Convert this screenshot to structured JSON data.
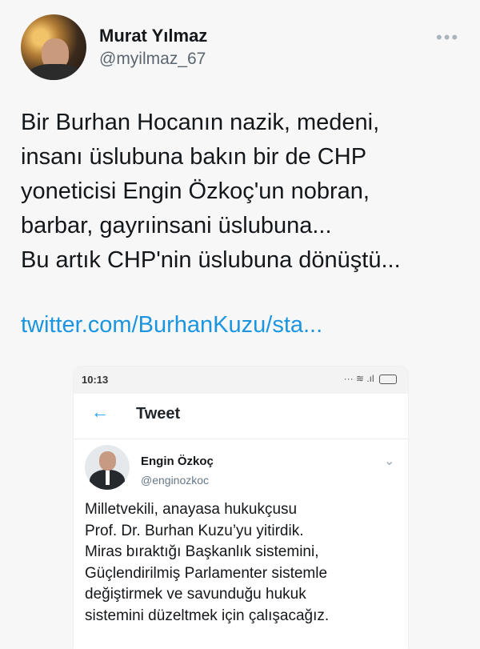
{
  "author": {
    "name": "Murat Yılmaz",
    "handle": "@myilmaz_67"
  },
  "more_icon": "ellipsis-icon",
  "tweet": {
    "text": "Bir Burhan Hocanın nazik, medeni,\ninsanı üslubuna bakın bir de CHP\nyoneticisi Engin Özkoç'un nobran,\nbarbar, gayrıinsani üslubuna...\nBu artık CHP'nin üslubuna dönüştü...",
    "link": "twitter.com/BurhanKuzu/sta..."
  },
  "embedded_screenshot": {
    "status_time": "10:13",
    "status_icons": "··· ≋ .ıl",
    "header_title": "Tweet",
    "back_icon": "back-arrow-icon",
    "inner_author": {
      "name": "Engin Özkoç",
      "handle": "@enginozkoc"
    },
    "inner_text": "Milletvekili, anayasa hukukçusu\nProf. Dr. Burhan Kuzu’yu yitirdik.\nMiras bıraktığı Başkanlık sistemini,\nGüçlendirilmiş Parlamenter sistemle\ndeğiştirmek ve savunduğu hukuk\nsistemini düzeltmek için çalışacağız."
  },
  "colors": {
    "link": "#1b95e0",
    "accent": "#1da1f2",
    "text": "#14171a",
    "secondary": "#5b6670"
  }
}
